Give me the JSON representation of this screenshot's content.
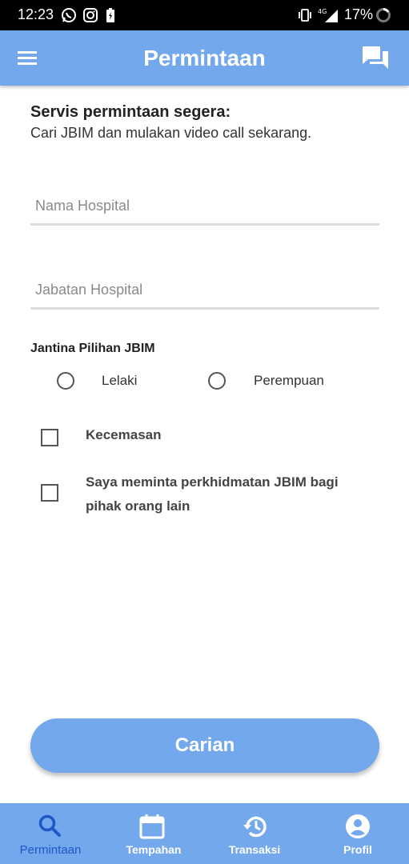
{
  "status_bar": {
    "time": "12:23",
    "battery_percent": "17%",
    "icons": [
      "whatsapp-icon",
      "instagram-icon",
      "battery-charging-icon",
      "vibrate-icon",
      "signal-4g-icon",
      "loading-ring-icon"
    ]
  },
  "app_bar": {
    "title": "Permintaan",
    "menu_icon": "menu-icon",
    "chat_icon": "chat-icon"
  },
  "intro": {
    "title": "Servis permintaan segera:",
    "subtitle": "Cari JBIM dan mulakan video call sekarang."
  },
  "form": {
    "hospital_name": {
      "placeholder": "Nama Hospital",
      "value": ""
    },
    "hospital_department": {
      "placeholder": "Jabatan Hospital",
      "value": ""
    },
    "gender_label": "Jantina Pilihan JBIM",
    "gender_options": [
      {
        "label": "Lelaki",
        "selected": false
      },
      {
        "label": "Perempuan",
        "selected": false
      }
    ],
    "checkboxes": [
      {
        "label": "Kecemasan",
        "checked": false
      },
      {
        "label_line1": "Saya meminta perkhidmatan JBIM bagi",
        "label_line2": "pihak orang lain",
        "checked": false
      }
    ]
  },
  "search_button": {
    "label": "Carian"
  },
  "bottom_nav": {
    "items": [
      {
        "label": "Permintaan",
        "icon": "search-icon",
        "active": true
      },
      {
        "label": "Tempahan",
        "icon": "calendar-icon",
        "active": false
      },
      {
        "label": "Transaksi",
        "icon": "history-icon",
        "active": false
      },
      {
        "label": "Profil",
        "icon": "account-icon",
        "active": false
      }
    ]
  },
  "colors": {
    "primary": "#73a8ec",
    "active_nav": "#1e56c8",
    "status_bar": "#000000"
  }
}
